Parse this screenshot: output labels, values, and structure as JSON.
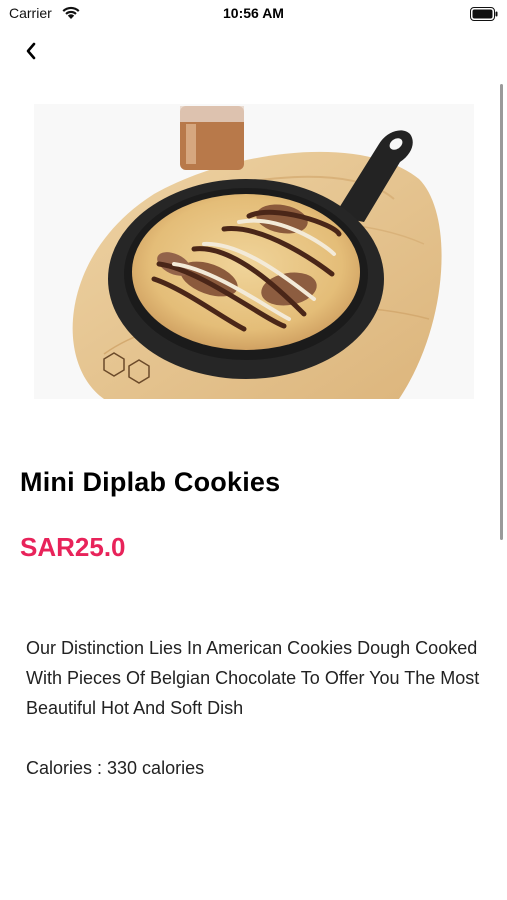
{
  "status_bar": {
    "carrier": "Carrier",
    "time": "10:56 AM"
  },
  "navigation": {
    "back_icon": "chevron-left-icon"
  },
  "product": {
    "name": "Mini Diplab Cookies",
    "price": "SAR25.0",
    "description": "Our Distinction Lies In American Cookies Dough Cooked With Pieces Of Belgian Chocolate To Offer You The Most Beautiful Hot And Soft Dish",
    "calories": "Calories : 330 calories"
  },
  "colors": {
    "price_accent": "#e8235a"
  }
}
